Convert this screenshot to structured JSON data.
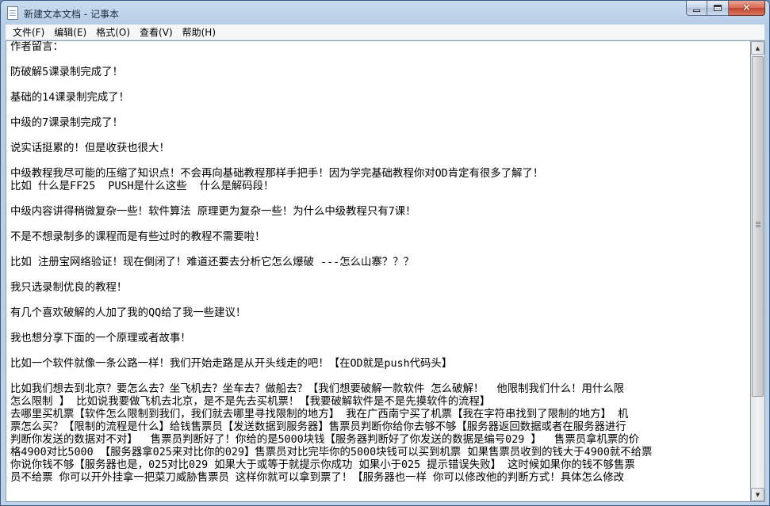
{
  "window": {
    "title": "新建文本文档 - 记事本"
  },
  "menu": {
    "items": [
      "文件(F)",
      "编辑(E)",
      "格式(O)",
      "查看(V)",
      "帮助(H)"
    ]
  },
  "document": {
    "lines": [
      "作者留言：",
      "",
      "防破解5课录制完成了！",
      "",
      "基础的14课录制完成了！",
      "",
      "中级的7课录制完成了！",
      "",
      "说实话挺累的！但是收获也很大！",
      "",
      "中级教程我尽可能的压缩了知识点！不会再向基础教程那样手把手！因为学完基础教程你对OD肯定有很多了解了！",
      "比如 什么是FF25  PUSH是什么这些  什么是解码段！",
      "",
      "中级内容讲得稍微复杂一些！软件算法 原理更为复杂一些！为什么中级教程只有7课！",
      "",
      "不是不想录制多的课程而是有些过时的教程不需要啦！",
      "",
      "比如 注册宝网络验证！现在倒闭了！难道还要去分析它怎么爆破 ---怎么山寨？？？",
      "",
      "我只选录制优良的教程！",
      "",
      "有几个喜欢破解的人加了我的QQ给了我一些建议！",
      "",
      "我也想分享下面的一个原理或者故事！",
      "",
      "比如一个软件就像一条公路一样！我们开始走路是从开头线走的吧！【在OD就是push代码头】",
      "",
      "比如我们想去到北京？要怎么去？坐飞机去？坐车去？做船去？【我们想要破解一款软件 怎么破解！  他限制我们什么！用什么限",
      "怎么限制 】 比如说我要做飞机去北京，是不是先去买机票！【我要破解软件是不是先摸软件的流程】",
      "去哪里买机票【软件怎么限制到我们，我们就去哪里寻找限制的地方】 我在广西南宁买了机票【我在字符串找到了限制的地方】 机",
      "票怎么买？【限制的流程是什么】给钱售票员【发送数据到服务器】售票员判断你给你去够不够【服务器返回数据或者在服务器进行",
      "判断你发送的数据对不对】  售票员判断好了！你给的是5000块钱【服务器判断好了你发送的数据是编号029 】  售票员拿机票的价",
      "格4900对比5000 【服务器拿025来对比你的029】售票员对比完毕你的5000块钱可以买到机票 如果售票员收到的钱大于4900就不给票",
      "你说你钱不够【服务器也是，025对比029 如果大于或等于就提示你成功 如果小于025 提示错误失败】 这时候如果你的钱不够售票",
      "员不给票 你可以开外挂拿一把菜刀威胁售票员 这样你就可以拿到票了！【服务器也一样 你可以修改他的判断方式！具体怎么修改"
    ]
  },
  "icons": {
    "app": "notepad-icon",
    "minimize": "minimize-icon",
    "maximize": "maximize-icon",
    "close": "close-icon"
  },
  "scrollbar": {
    "up_arrow": "▲",
    "down_arrow": "▼",
    "position": 0
  }
}
